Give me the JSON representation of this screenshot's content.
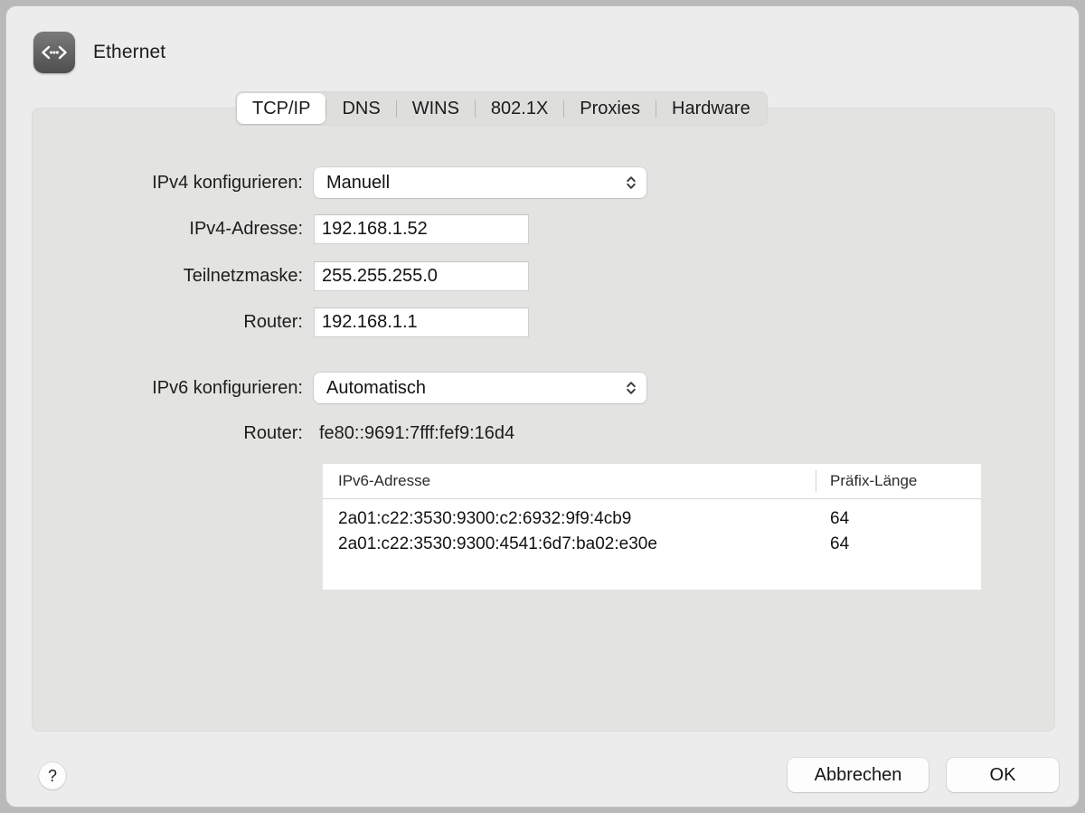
{
  "window": {
    "title": "Ethernet",
    "icon": "ethernet-icon"
  },
  "tabs": [
    {
      "label": "TCP/IP",
      "selected": true
    },
    {
      "label": "DNS",
      "selected": false
    },
    {
      "label": "WINS",
      "selected": false
    },
    {
      "label": "802.1X",
      "selected": false
    },
    {
      "label": "Proxies",
      "selected": false
    },
    {
      "label": "Hardware",
      "selected": false
    }
  ],
  "ipv4": {
    "configure_label": "IPv4 konfigurieren:",
    "configure_value": "Manuell",
    "address_label": "IPv4-Adresse:",
    "address_value": "192.168.1.52",
    "subnet_label": "Teilnetzmaske:",
    "subnet_value": "255.255.255.0",
    "router_label": "Router:",
    "router_value": "192.168.1.1"
  },
  "ipv6": {
    "configure_label": "IPv6 konfigurieren:",
    "configure_value": "Automatisch",
    "router_label": "Router:",
    "router_value": "fe80::9691:7fff:fef9:16d4",
    "table": {
      "headers": {
        "address": "IPv6-Adresse",
        "prefix_length": "Präfix-Länge"
      },
      "rows": [
        {
          "address": "2a01:c22:3530:9300:c2:6932:9f9:4cb9",
          "prefix_length": "64"
        },
        {
          "address": "2a01:c22:3530:9300:4541:6d7:ba02:e30e",
          "prefix_length": "64"
        }
      ]
    }
  },
  "footer": {
    "help_label": "?",
    "cancel_label": "Abbrechen",
    "ok_label": "OK"
  },
  "colors": {
    "window_background": "#ececec",
    "panel_background": "#e3e3e1",
    "tabbar_background": "#dededc",
    "field_background": "#ffffff",
    "text": "#1d1d1d"
  }
}
